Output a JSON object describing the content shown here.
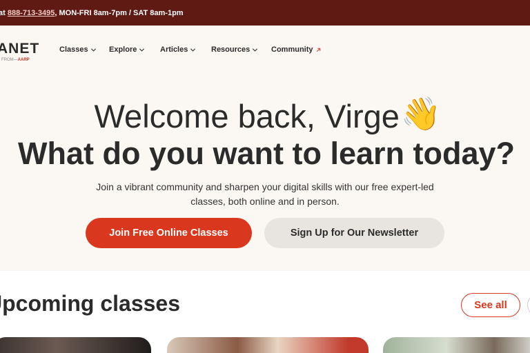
{
  "topbar": {
    "prefix": "at ",
    "phone": "888-713-3495",
    "hours": ", MON-FRI 8am-7pm / SAT 8am-1pm"
  },
  "logo": {
    "word": "ANET",
    "from_prefix": "FROM",
    "from_brand": "AARP"
  },
  "nav": {
    "items": [
      {
        "label": "Classes",
        "icon": "chevron-down-icon"
      },
      {
        "label": "Explore",
        "icon": "chevron-down-icon"
      },
      {
        "label": "Articles",
        "icon": "chevron-down-icon"
      },
      {
        "label": "Resources",
        "icon": "chevron-down-icon"
      },
      {
        "label": "Community",
        "icon": "external-link-icon"
      }
    ]
  },
  "hero": {
    "greeting": "Welcome back, Virge",
    "wave_emoji": "👋",
    "headline": "What do you want to learn today?",
    "subtitle": "Join a vibrant community and sharpen your digital skills with our free expert-led classes, both online and in person.",
    "primary_button": "Join Free Online Classes",
    "secondary_button": "Sign Up for Our Newsletter"
  },
  "upcoming": {
    "title": "Upcoming classes",
    "see_all": "See all"
  },
  "colors": {
    "topbar": "#5f1a14",
    "accent": "#d9381e",
    "hero_bg": "#fbf8f3"
  }
}
